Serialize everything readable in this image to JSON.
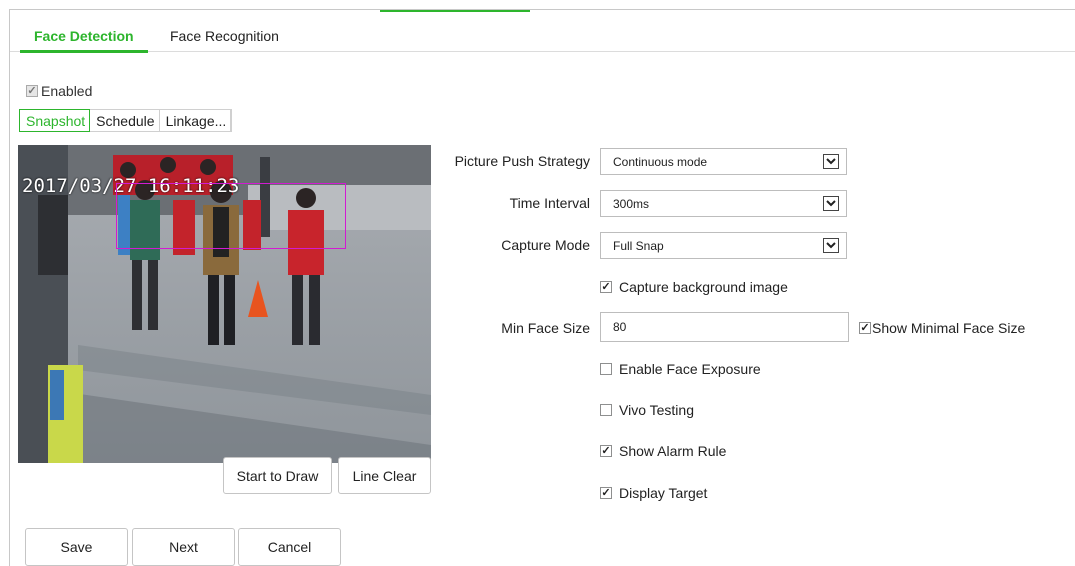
{
  "tabs": [
    {
      "label": "Face Detection",
      "active": true
    },
    {
      "label": "Face Recognition",
      "active": false
    }
  ],
  "enabled": {
    "label": "Enabled",
    "checked": true
  },
  "subtabs": [
    {
      "label": "Snapshot",
      "active": true
    },
    {
      "label": "Schedule",
      "active": false
    },
    {
      "label": "Linkage...",
      "active": false
    }
  ],
  "video": {
    "osd_text": "2017/03/27 16:11:23"
  },
  "draw_buttons": {
    "start": "Start to Draw",
    "clear": "Line Clear"
  },
  "settings": {
    "picture_push_strategy": {
      "label": "Picture Push Strategy",
      "value": "Continuous mode"
    },
    "time_interval": {
      "label": "Time Interval",
      "value": "300ms"
    },
    "capture_mode": {
      "label": "Capture Mode",
      "value": "Full Snap"
    },
    "capture_background": {
      "label": "Capture background image",
      "checked": true
    },
    "min_face_size": {
      "label": "Min Face Size",
      "value": "80"
    },
    "show_minimal_face": {
      "label": "Show Minimal Face Size",
      "checked": true
    },
    "enable_face_exposure": {
      "label": "Enable Face Exposure",
      "checked": false
    },
    "vivo_testing": {
      "label": "Vivo Testing",
      "checked": false
    },
    "show_alarm_rule": {
      "label": "Show Alarm Rule",
      "checked": true
    },
    "display_target": {
      "label": "Display Target",
      "checked": true
    }
  },
  "footer": {
    "save": "Save",
    "next": "Next",
    "cancel": "Cancel"
  },
  "colors": {
    "accent": "#2db52d",
    "draw_rect": "#d21bd2"
  }
}
